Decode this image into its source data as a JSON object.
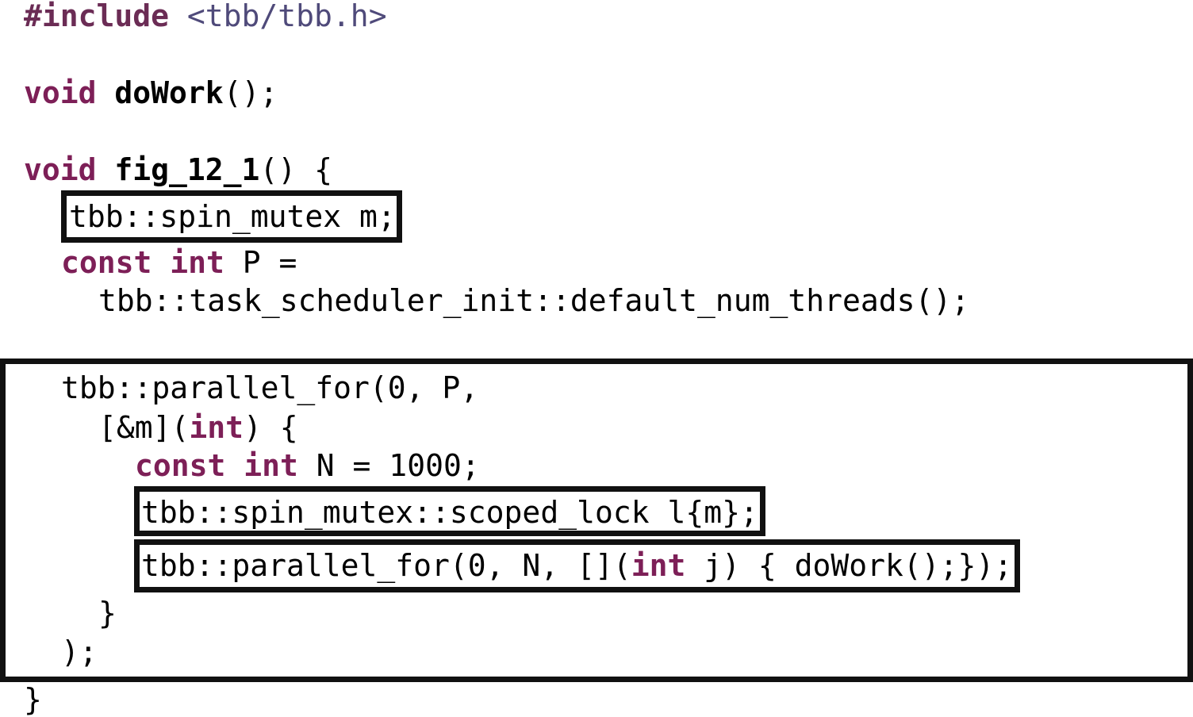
{
  "code": {
    "l1_directive": "#include",
    "l1_header": " <tbb/tbb.h>",
    "l2_kw": "void",
    "l2_fn": "doWork",
    "l2_rest": "();",
    "l3_kw": "void",
    "l3_fn": "fig_12_1",
    "l3_rest": "() {",
    "l4": "tbb::spin_mutex m;",
    "l5_kw1": "const",
    "l5_kw2": "int",
    "l5_rest": " P =",
    "l6": "tbb::task_scheduler_init::default_num_threads();",
    "l7": "tbb::parallel_for(0, P,",
    "l8_pre": "[&m](",
    "l8_kw": "int",
    "l8_post": ") {",
    "l9_kw1": "const",
    "l9_kw2": "int",
    "l9_rest": " N = 1000;",
    "l10": "tbb::spin_mutex::scoped_lock l{m};",
    "l11_pre": "tbb::parallel_for(0, N, [](",
    "l11_kw": "int",
    "l11_post": " j) { doWork();});",
    "l12": "}",
    "l13": ");",
    "l14": "}"
  }
}
